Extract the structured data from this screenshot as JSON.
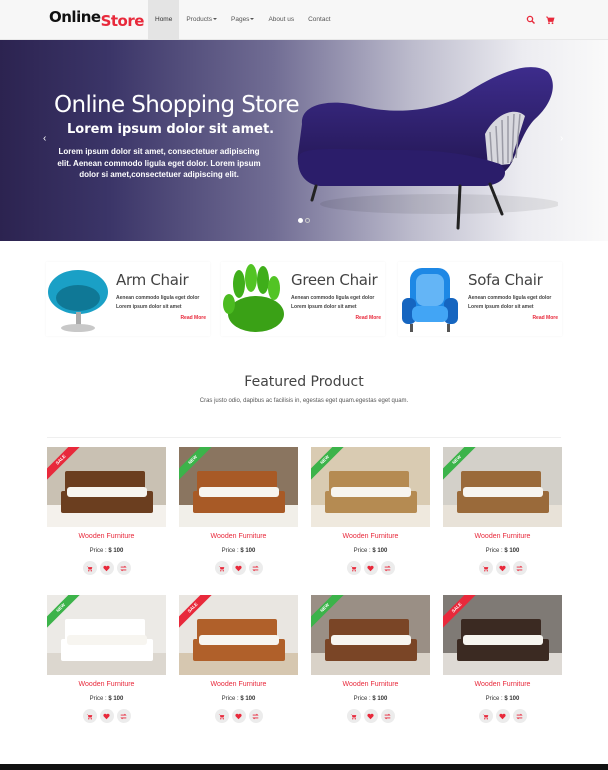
{
  "header": {
    "logo_part1": "Online",
    "logo_part2": "Store",
    "nav": [
      {
        "label": "Home"
      },
      {
        "label": "Products"
      },
      {
        "label": "Pages"
      },
      {
        "label": "About us"
      },
      {
        "label": "Contact"
      }
    ],
    "icons": [
      "search-icon",
      "cart-icon"
    ]
  },
  "hero": {
    "title": "Online Shopping Store",
    "subtitle": "Lorem ipsum dolor sit amet.",
    "text": "Lorem ipsum dolor sit amet, consectetuer adipiscing elit. Aenean commodo ligula eget dolor. Lorem ipsum dolor si amet,consectetuer adipiscing elit.",
    "prev_arrow": "‹",
    "next_arrow": "›",
    "slide_count": 2,
    "active_slide": 1
  },
  "categories": [
    {
      "title": "Arm Chair",
      "desc": "Aenean commodo ligula eget dolor Lorem ipsum dolor sit amet",
      "more": "Read More"
    },
    {
      "title": "Green Chair",
      "desc": "Aenean commodo ligula eget dolor Lorem ipsum dolor sit amet",
      "more": "Read More"
    },
    {
      "title": "Sofa Chair",
      "desc": "Aenean commodo ligula eget dolor Lorem ipsum dolor sit amet",
      "more": "Read More"
    }
  ],
  "featured": {
    "title": "Featured Product",
    "subtitle": "Cras justo odio, dapibus ac facilisis in, egestas eget quam.egestas eget quam.",
    "products": [
      {
        "name": "Wooden Furniture",
        "price_label": "Price :",
        "price": "$ 100",
        "badge": "SALE"
      },
      {
        "name": "Wooden Furniture",
        "price_label": "Price :",
        "price": "$ 100",
        "badge": "NEW"
      },
      {
        "name": "Wooden Furniture",
        "price_label": "Price :",
        "price": "$ 100",
        "badge": "NEW"
      },
      {
        "name": "Wooden Furniture",
        "price_label": "Price :",
        "price": "$ 100",
        "badge": "NEW"
      },
      {
        "name": "Wooden Furniture",
        "price_label": "Price :",
        "price": "$ 100",
        "badge": "NEW"
      },
      {
        "name": "Wooden Furniture",
        "price_label": "Price :",
        "price": "$ 100",
        "badge": "SALE"
      },
      {
        "name": "Wooden Furniture",
        "price_label": "Price :",
        "price": "$ 100",
        "badge": "NEW"
      },
      {
        "name": "Wooden Furniture",
        "price_label": "Price :",
        "price": "$ 100",
        "badge": "SALE"
      }
    ]
  },
  "colors": {
    "accent": "#e8293b",
    "sale_ribbon": "#e8293b",
    "new_ribbon": "#3cb34a",
    "hero_dark": "#2c2350"
  }
}
